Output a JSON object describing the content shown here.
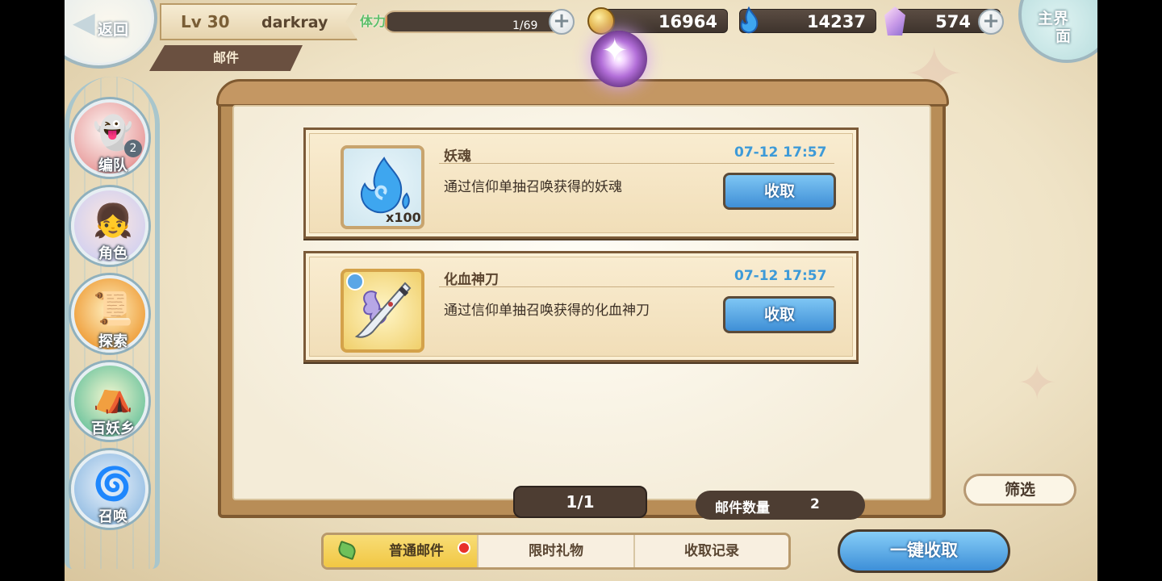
{
  "header": {
    "back_label": "返回",
    "level": "Lv 30",
    "username": "darkray",
    "section_title": "邮件",
    "stamina_label": "体力",
    "stamina_text": "1/69",
    "stamina_fraction": 0.0145,
    "gold": "16964",
    "soul": "14237",
    "crystal": "574",
    "home_label_line1": "主界",
    "home_label_line2": "面"
  },
  "nav": [
    {
      "label": "编队",
      "icon": "team-icon",
      "badge": "2"
    },
    {
      "label": "角色",
      "icon": "character-icon"
    },
    {
      "label": "探索",
      "icon": "explore-icon"
    },
    {
      "label": "百妖乡",
      "icon": "village-icon"
    },
    {
      "label": "召唤",
      "icon": "summon-icon"
    }
  ],
  "mails": [
    {
      "title": "妖魂",
      "time": "07-12 17:57",
      "description": "通过信仰单抽召唤获得的妖魂",
      "count": "x100",
      "icon": "blue-flame-icon",
      "button": "收取"
    },
    {
      "title": "化血神刀",
      "time": "07-12 17:57",
      "description": "通过信仰单抽召唤获得的化血神刀",
      "count": "",
      "icon": "blade-icon",
      "button": "收取"
    }
  ],
  "footer": {
    "page": "1/1",
    "mail_count_label": "邮件数量",
    "mail_count": "2",
    "filter": "筛选",
    "tabs": [
      "普通邮件",
      "限时礼物",
      "收取记录"
    ],
    "collect_all": "一键收取"
  },
  "colors": {
    "accent_blue": "#3f8fd6",
    "time_blue": "#3d9ad8",
    "frame_brown": "#7b5a38",
    "tab_active": "#f1c743"
  }
}
